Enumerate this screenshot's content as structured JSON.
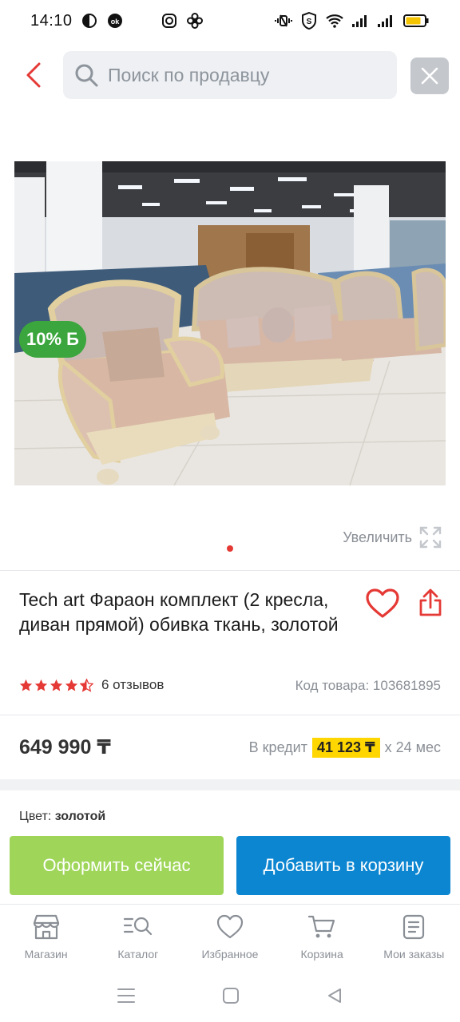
{
  "status_bar": {
    "time": "14:10",
    "left_icons": [
      "moon-circle-icon",
      "ok-icon",
      "instagram-icon",
      "fan-icon"
    ],
    "right_icons": [
      "vibrate-icon",
      "shield-s-icon",
      "wifi-icon",
      "signal-icon",
      "signal-icon",
      "battery-icon"
    ]
  },
  "search": {
    "placeholder": "Поиск по продавцу",
    "value": ""
  },
  "product": {
    "discount_badge": "10% Б",
    "enlarge_label": "Увеличить",
    "title": "Tech art Фараон комплект (2 кресла, диван прямой) обивка ткань, золотой",
    "rating": 4.5,
    "reviews": "6 отзывов",
    "code": "Код товара: 103681895",
    "price": "649 990 ₸",
    "credit_prefix": "В кредит",
    "credit_amount": "41 123 ₸",
    "credit_suffix": "х 24 мес",
    "color_label": "Цвет:",
    "color_value": "золотой"
  },
  "actions": {
    "buy_now": "Оформить сейчас",
    "add_to_cart": "Добавить в корзину"
  },
  "bottom_nav": {
    "items": [
      {
        "label": "Магазин",
        "icon": "shop-icon"
      },
      {
        "label": "Каталог",
        "icon": "catalog-search-icon"
      },
      {
        "label": "Избранное",
        "icon": "heart-icon"
      },
      {
        "label": "Корзина",
        "icon": "cart-icon"
      },
      {
        "label": "Мои заказы",
        "icon": "orders-icon"
      }
    ]
  },
  "colors": {
    "accent_red": "#e53935",
    "green_badge": "#3aa63d",
    "buy_button": "#9fd65a",
    "cart_button": "#0d86d1",
    "credit_highlight": "#ffd600"
  }
}
